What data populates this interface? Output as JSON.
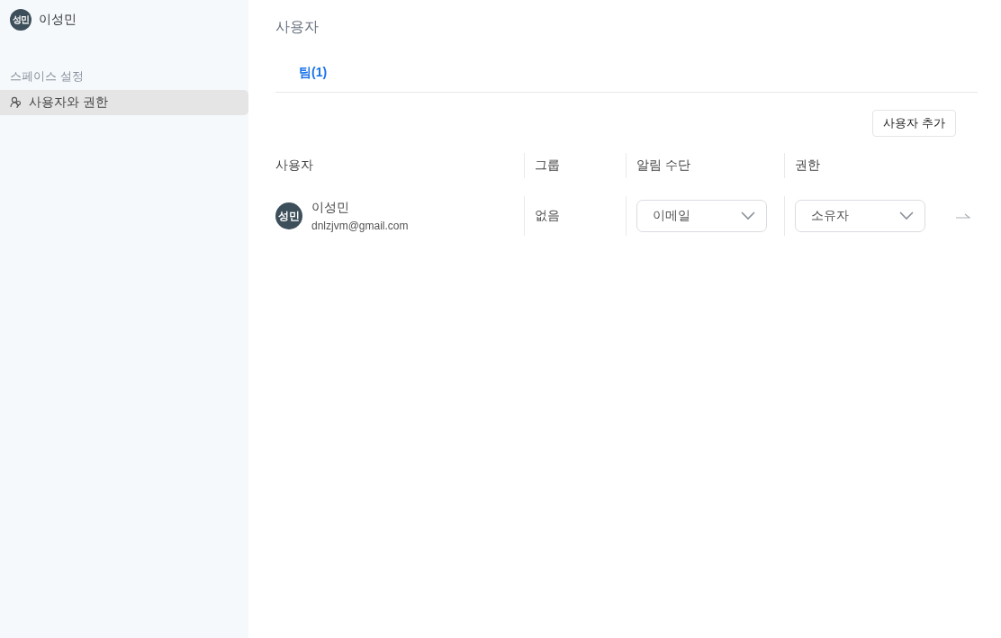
{
  "sidebar": {
    "profile": {
      "initials": "성민",
      "name": "이성민"
    },
    "section_title": "스페이스 설정",
    "items": [
      {
        "label": "사용자와 권한",
        "selected": true
      }
    ]
  },
  "main": {
    "title": "사용자",
    "tabs": [
      {
        "label": "팀(1)",
        "selected": true
      }
    ],
    "add_button": "사용자 추가",
    "table": {
      "columns": [
        "사용자",
        "그룹",
        "알림 수단",
        "권한"
      ],
      "rows": [
        {
          "initials": "성민",
          "name": "이성민",
          "email": "dnlzjvm@gmail.com",
          "group": "없음",
          "notify": "이메일",
          "role": "소유자"
        }
      ]
    }
  }
}
